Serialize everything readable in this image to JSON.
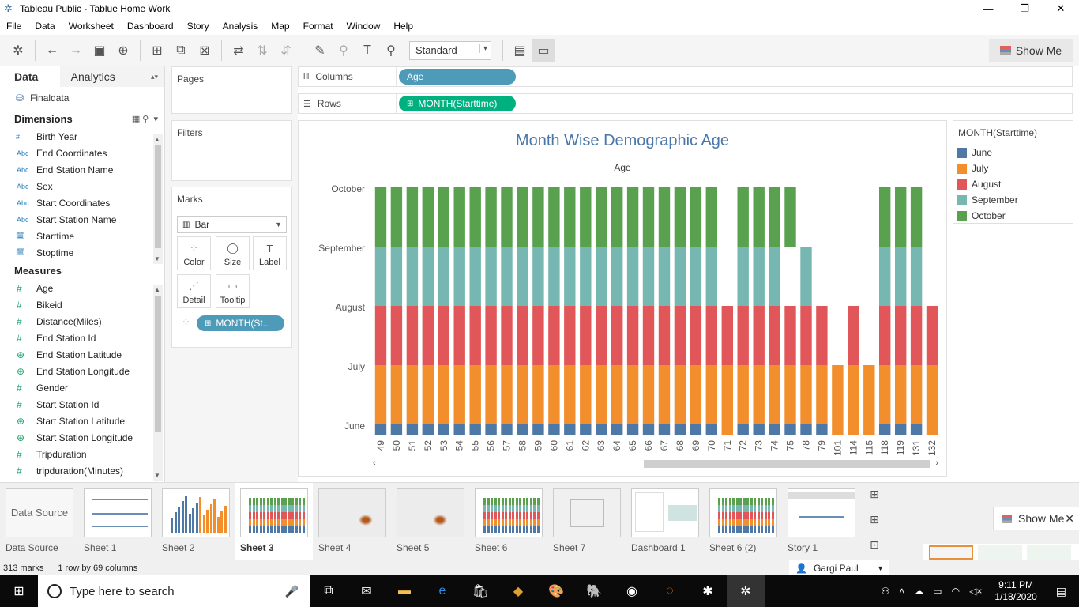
{
  "window": {
    "title": "Tableau Public - Tablue Home Work"
  },
  "menu": [
    "File",
    "Data",
    "Worksheet",
    "Dashboard",
    "Story",
    "Analysis",
    "Map",
    "Format",
    "Window",
    "Help"
  ],
  "toolbar": {
    "fit_select": "Standard",
    "show_me": "Show Me"
  },
  "data_pane": {
    "tab_data": "Data",
    "tab_analytics": "Analytics",
    "datasource": "Finaldata",
    "dimensions_header": "Dimensions",
    "dimensions": [
      {
        "type": "#",
        "name": "Birth Year"
      },
      {
        "type": "Abc",
        "name": "End Coordinates"
      },
      {
        "type": "Abc",
        "name": "End Station Name"
      },
      {
        "type": "Abc",
        "name": "Sex"
      },
      {
        "type": "Abc",
        "name": "Start Coordinates"
      },
      {
        "type": "Abc",
        "name": "Start Station Name"
      },
      {
        "type": "date",
        "name": "Starttime"
      },
      {
        "type": "date",
        "name": "Stoptime"
      }
    ],
    "measures_header": "Measures",
    "measures": [
      {
        "type": "#",
        "name": "Age"
      },
      {
        "type": "#",
        "name": "Bikeid"
      },
      {
        "type": "#",
        "name": "Distance(Miles)"
      },
      {
        "type": "#",
        "name": "End Station Id"
      },
      {
        "type": "geo",
        "name": "End Station Latitude"
      },
      {
        "type": "geo",
        "name": "End Station Longitude"
      },
      {
        "type": "#",
        "name": "Gender"
      },
      {
        "type": "#",
        "name": "Start Station Id"
      },
      {
        "type": "geo",
        "name": "Start Station Latitude"
      },
      {
        "type": "geo",
        "name": "Start Station Longitude"
      },
      {
        "type": "#",
        "name": "Tripduration"
      },
      {
        "type": "#",
        "name": "tripduration(Minutes)"
      }
    ]
  },
  "cards": {
    "pages": "Pages",
    "filters": "Filters",
    "marks": "Marks",
    "mark_type": "Bar",
    "mark_buttons": [
      "Color",
      "Size",
      "Label",
      "Detail",
      "Tooltip"
    ],
    "color_pill": "MONTH(St.."
  },
  "shelves": {
    "columns_label": "Columns",
    "columns_pill": "Age",
    "rows_label": "Rows",
    "rows_pill": "MONTH(Starttime)"
  },
  "legend": {
    "title": "MONTH(Starttime)",
    "items": [
      {
        "label": "June",
        "color": "#4e79a7"
      },
      {
        "label": "July",
        "color": "#f28e2b"
      },
      {
        "label": "August",
        "color": "#e15759"
      },
      {
        "label": "September",
        "color": "#76b7b2"
      },
      {
        "label": "October",
        "color": "#59a14f"
      }
    ]
  },
  "chart_data": {
    "type": "bar",
    "title": "Month Wise Demographic Age",
    "xlabel": "Age",
    "ylabel": "",
    "y_categories": [
      "June",
      "July",
      "August",
      "September",
      "October"
    ],
    "colors": {
      "June": "#4e79a7",
      "July": "#f28e2b",
      "August": "#e15759",
      "September": "#76b7b2",
      "October": "#59a14f"
    },
    "categories": [
      "49",
      "50",
      "51",
      "52",
      "53",
      "54",
      "55",
      "56",
      "57",
      "58",
      "59",
      "60",
      "61",
      "62",
      "63",
      "64",
      "65",
      "66",
      "67",
      "68",
      "69",
      "70",
      "71",
      "72",
      "73",
      "74",
      "75",
      "78",
      "79",
      "101",
      "114",
      "115",
      "118",
      "119",
      "131",
      "132"
    ],
    "months_present": [
      [
        "June",
        "July",
        "August",
        "September",
        "October"
      ],
      [
        "June",
        "July",
        "August",
        "September",
        "October"
      ],
      [
        "June",
        "July",
        "August",
        "September",
        "October"
      ],
      [
        "June",
        "July",
        "August",
        "September",
        "October"
      ],
      [
        "June",
        "July",
        "August",
        "September",
        "October"
      ],
      [
        "June",
        "July",
        "August",
        "September",
        "October"
      ],
      [
        "June",
        "July",
        "August",
        "September",
        "October"
      ],
      [
        "June",
        "July",
        "August",
        "September",
        "October"
      ],
      [
        "June",
        "July",
        "August",
        "September",
        "October"
      ],
      [
        "June",
        "July",
        "August",
        "September",
        "October"
      ],
      [
        "June",
        "July",
        "August",
        "September",
        "October"
      ],
      [
        "June",
        "July",
        "August",
        "September",
        "October"
      ],
      [
        "June",
        "July",
        "August",
        "September",
        "October"
      ],
      [
        "June",
        "July",
        "August",
        "September",
        "October"
      ],
      [
        "June",
        "July",
        "August",
        "September",
        "October"
      ],
      [
        "June",
        "July",
        "August",
        "September",
        "October"
      ],
      [
        "June",
        "July",
        "August",
        "September",
        "October"
      ],
      [
        "June",
        "July",
        "August",
        "September",
        "October"
      ],
      [
        "June",
        "July",
        "August",
        "September",
        "October"
      ],
      [
        "June",
        "July",
        "August",
        "September",
        "October"
      ],
      [
        "June",
        "July",
        "August",
        "September",
        "October"
      ],
      [
        "June",
        "July",
        "August",
        "September",
        "October"
      ],
      [
        "July",
        "August"
      ],
      [
        "June",
        "July",
        "August",
        "September",
        "October"
      ],
      [
        "June",
        "July",
        "August",
        "September",
        "October"
      ],
      [
        "June",
        "July",
        "August",
        "September",
        "October"
      ],
      [
        "June",
        "July",
        "August",
        "October"
      ],
      [
        "June",
        "July",
        "August",
        "September"
      ],
      [
        "June",
        "July",
        "August"
      ],
      [
        "July"
      ],
      [
        "July",
        "August"
      ],
      [
        "July"
      ],
      [
        "June",
        "July",
        "August",
        "September",
        "October"
      ],
      [
        "June",
        "July",
        "August",
        "September",
        "October"
      ],
      [
        "June",
        "July",
        "August",
        "September",
        "October"
      ],
      [
        "July",
        "August"
      ]
    ]
  },
  "sheets": [
    {
      "label": "Data Source",
      "icon": "database-icon"
    },
    {
      "label": "Sheet 1"
    },
    {
      "label": "Sheet 2"
    },
    {
      "label": "Sheet 3",
      "active": true
    },
    {
      "label": "Sheet 4"
    },
    {
      "label": "Sheet 5"
    },
    {
      "label": "Sheet 6"
    },
    {
      "label": "Sheet 7"
    },
    {
      "label": "Dashboard 1"
    },
    {
      "label": "Sheet 6 (2)"
    },
    {
      "label": "Story 1"
    }
  ],
  "floating_show_me": "Show Me",
  "status": {
    "marks": "313 marks",
    "dims": "1 row by 69 columns",
    "user": "Gargi Paul"
  },
  "taskbar": {
    "search_placeholder": "Type here to search",
    "time": "9:11 PM",
    "date": "1/18/2020"
  }
}
